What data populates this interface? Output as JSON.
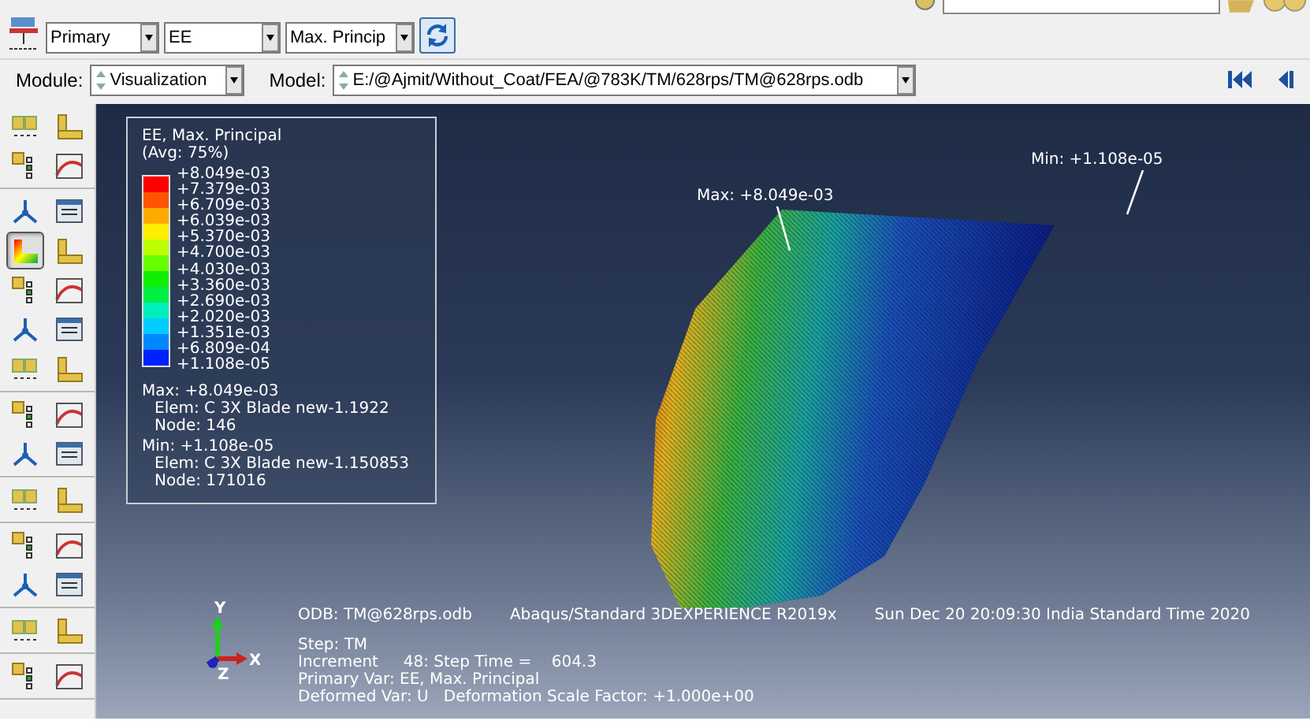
{
  "toolbar": {
    "step_combo": "Primary",
    "variable_combo": "EE",
    "invariant_combo": "Max. Princip"
  },
  "context_bar": {
    "module_label": "Module:",
    "module": "Visualization",
    "model_label": "Model:",
    "model": "E:/@Ajmit/Without_Coat/FEA/@783K/TM/628rps/TM@628rps.odb"
  },
  "toolbox": {
    "groups": [
      {
        "tools": [
          {
            "selected": false
          },
          {
            "selected": false
          },
          {
            "selected": false
          },
          {
            "selected": false
          }
        ]
      },
      {
        "tools": [
          {
            "selected": false
          },
          {
            "selected": false
          },
          {
            "selected": true
          },
          {
            "selected": false
          },
          {
            "selected": false
          },
          {
            "selected": false
          },
          {
            "selected": false
          },
          {
            "selected": false
          },
          {
            "selected": false
          },
          {
            "selected": false
          }
        ]
      },
      {
        "tools": [
          {
            "selected": false
          },
          {
            "selected": false
          },
          {
            "selected": false
          },
          {
            "selected": false
          }
        ]
      },
      {
        "tools": [
          {
            "selected": false
          },
          {
            "selected": false
          }
        ]
      },
      {
        "tools": [
          {
            "selected": false
          },
          {
            "selected": false
          },
          {
            "selected": false
          },
          {
            "selected": false
          }
        ]
      },
      {
        "tools": [
          {
            "selected": false
          },
          {
            "selected": false
          }
        ]
      },
      {
        "tools": [
          {
            "selected": false
          },
          {
            "selected": false
          }
        ]
      }
    ]
  },
  "viewport": {
    "legend": {
      "title": "EE, Max. Principal",
      "averaging": "(Avg: 75%)",
      "scale_labels": [
        "+8.049e-03",
        "+7.379e-03",
        "+6.709e-03",
        "+6.039e-03",
        "+5.370e-03",
        "+4.700e-03",
        "+4.030e-03",
        "+3.360e-03",
        "+2.690e-03",
        "+2.020e-03",
        "+1.351e-03",
        "+6.809e-04",
        "+1.108e-05"
      ],
      "bands": [
        {
          "color": "#ff0000"
        },
        {
          "color": "#ff5500"
        },
        {
          "color": "#ffaa00"
        },
        {
          "color": "#ffee00"
        },
        {
          "color": "#bbff00"
        },
        {
          "color": "#66ff00"
        },
        {
          "color": "#11ee00"
        },
        {
          "color": "#00ee44"
        },
        {
          "color": "#00eebb"
        },
        {
          "color": "#00ccff"
        },
        {
          "color": "#0088ff"
        },
        {
          "color": "#0022ff"
        }
      ],
      "max": {
        "value": "Max: +8.049e-03",
        "elem": "Elem: C 3X Blade new-1.1922",
        "node": "Node: 146"
      },
      "min": {
        "value": "Min: +1.108e-05",
        "elem": "Elem: C 3X Blade new-1.150853",
        "node": "Node: 171016"
      }
    },
    "annotations": [
      {
        "kind": "max",
        "text": "Max: +8.049e-03"
      },
      {
        "kind": "min",
        "text": "Min: +1.108e-05"
      }
    ],
    "triad": {
      "x": "X",
      "y": "Y",
      "z": "Z"
    },
    "info": {
      "odb": "ODB: TM@628rps.odb",
      "solver": "Abaqus/Standard 3DEXPERIENCE R2019x",
      "date": "Sun Dec 20 20:09:30 India Standard Time 2020",
      "step": "Step: TM",
      "increment": "Increment     48: Step Time =    604.3",
      "primary_var": "Primary Var: EE, Max. Principal",
      "deformed_var": "Deformed Var: U   Deformation Scale Factor: +1.000e+00"
    }
  }
}
